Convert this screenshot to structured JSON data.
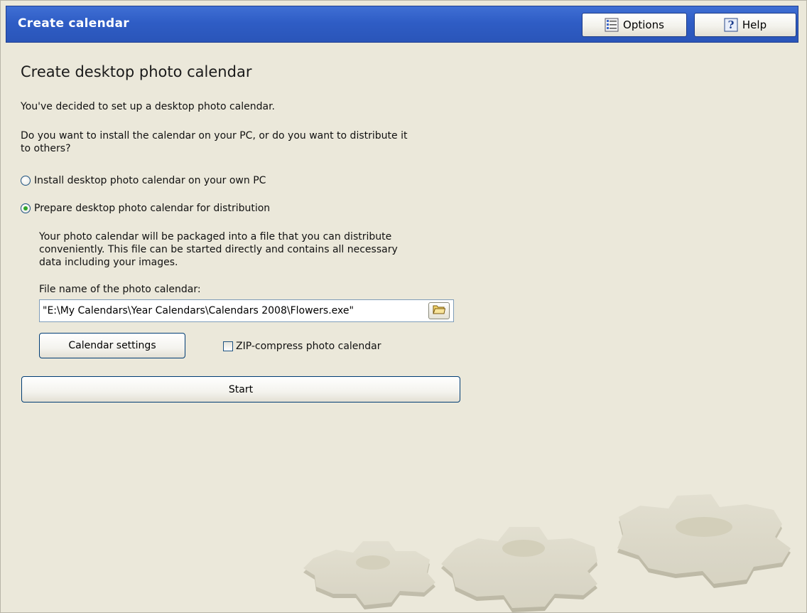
{
  "header": {
    "title": "Create calendar",
    "options_label": "Options",
    "help_label": "Help"
  },
  "main": {
    "heading": "Create desktop photo calendar",
    "intro": "You've decided to set up a desktop photo calendar.",
    "question_line1": "Do you want to install the calendar on your PC, or do you want to distribute it",
    "question_line2": "to others?",
    "options": [
      {
        "label": "Install desktop photo calendar on your own PC",
        "selected": false
      },
      {
        "label": "Prepare desktop photo calendar for distribution",
        "selected": true
      }
    ],
    "description_line1": "Your photo calendar will be packaged into a file that you can distribute",
    "description_line2": "conveniently. This file can be started directly and contains all necessary",
    "description_line3": "data including your images.",
    "file_label": "File name of the photo calendar:",
    "file_value": "\"E:\\My Calendars\\Year Calendars\\Calendars 2008\\Flowers.exe\"",
    "settings_button": "Calendar settings",
    "zip_label": "ZIP-compress photo calendar",
    "zip_checked": false,
    "start_button": "Start"
  },
  "icons": {
    "options": "list-icon",
    "help": "help-icon",
    "browse": "folder-icon",
    "decoration": "gears-decoration"
  },
  "colors": {
    "titlebar": "#2f5dc5",
    "background": "#ebe8da",
    "radio_selected": "#2fa52a"
  }
}
